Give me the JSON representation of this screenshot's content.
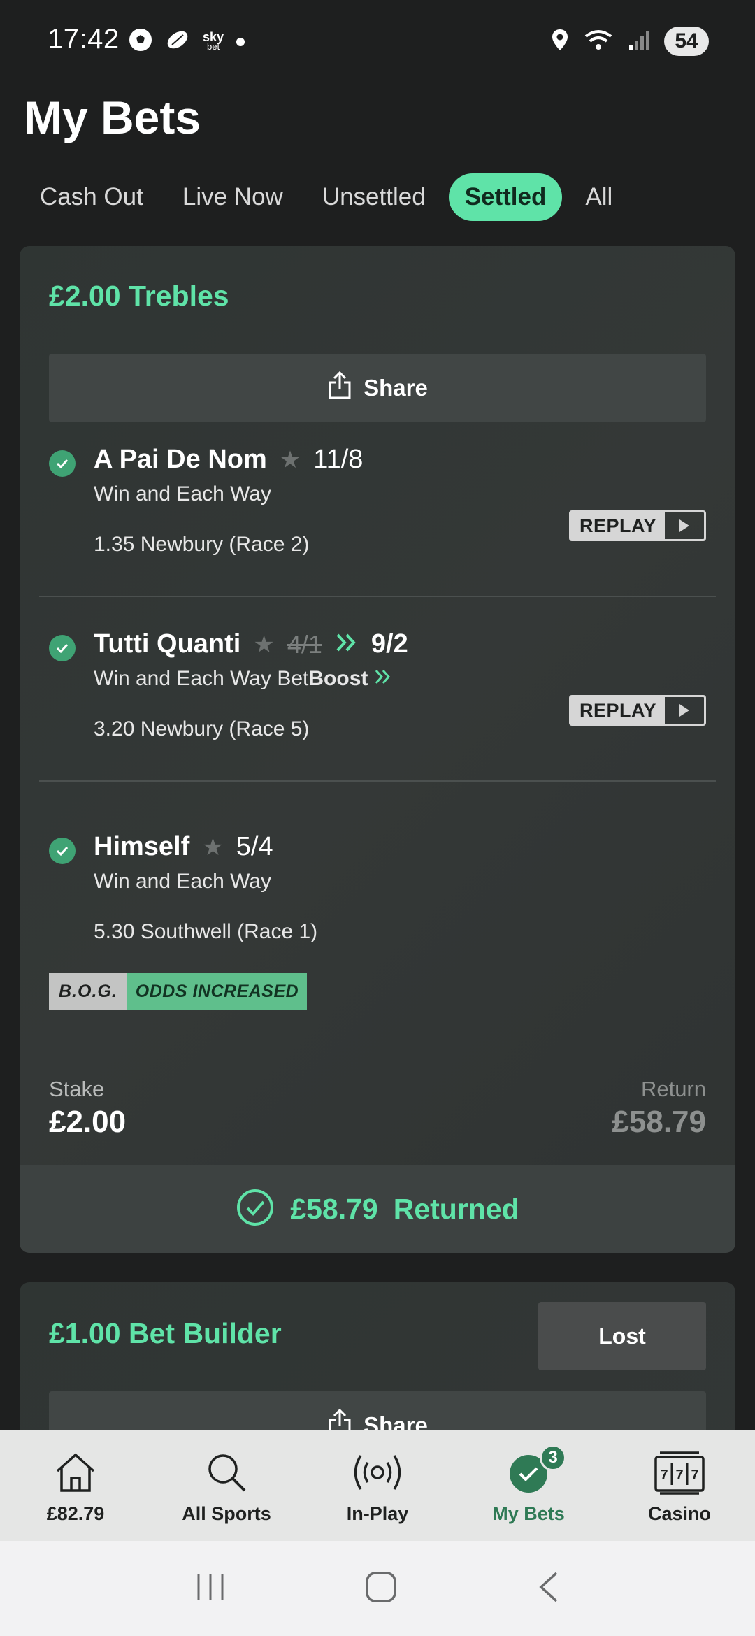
{
  "status_bar": {
    "time": "17:42",
    "left_icons": [
      "football-icon",
      "rugby-icon",
      "sky-bet-icon",
      "notification-dot"
    ],
    "sky_text": "sky",
    "sky_sub": "bet",
    "right_icons": [
      "location-icon",
      "wifi-icon",
      "signal-icon"
    ],
    "battery": "54"
  },
  "page": {
    "title": "My Bets"
  },
  "tabs": [
    {
      "label": "Cash Out",
      "active": false
    },
    {
      "label": "Live Now",
      "active": false
    },
    {
      "label": "Unsettled",
      "active": false
    },
    {
      "label": "Settled",
      "active": true
    },
    {
      "label": "All",
      "active": false
    }
  ],
  "bet1": {
    "title": "£2.00 Trebles",
    "share_label": "Share",
    "legs": [
      {
        "name": "A Pai De Nom",
        "odds": "11/8",
        "market": "Win and Each Way",
        "race": "1.35 Newbury (Race 2)",
        "replay": "REPLAY"
      },
      {
        "name": "Tutti Quanti",
        "odds_old": "4/1",
        "odds": "9/2",
        "market": "Win and Each Way",
        "boost_prefix": "Bet",
        "boost": "Boost",
        "race": "3.20 Newbury (Race 5)",
        "replay": "REPLAY"
      },
      {
        "name": "Himself",
        "odds": "5/4",
        "market": "Win and Each Way",
        "race": "5.30 Southwell (Race 1)"
      }
    ],
    "bog_label": "B.O.G.",
    "bog_status": "ODDS INCREASED",
    "stake_label": "Stake",
    "stake": "£2.00",
    "return_label": "Return",
    "return": "£58.79",
    "returned_amount": "£58.79",
    "returned_label": "Returned"
  },
  "bet2": {
    "title": "£1.00 Bet Builder",
    "status": "Lost",
    "share_label": "Share"
  },
  "bottom_nav": [
    {
      "label": "£82.79",
      "icon": "home-icon"
    },
    {
      "label": "All Sports",
      "icon": "search-icon"
    },
    {
      "label": "In-Play",
      "icon": "live-icon"
    },
    {
      "label": "My Bets",
      "icon": "check-icon",
      "badge": "3",
      "active": true
    },
    {
      "label": "Casino",
      "icon": "slot-machine-icon"
    }
  ],
  "colors": {
    "accent": "#5fe3a8",
    "background": "#1e1f1f",
    "card": "#323736",
    "nav_active": "#2f7a55"
  }
}
